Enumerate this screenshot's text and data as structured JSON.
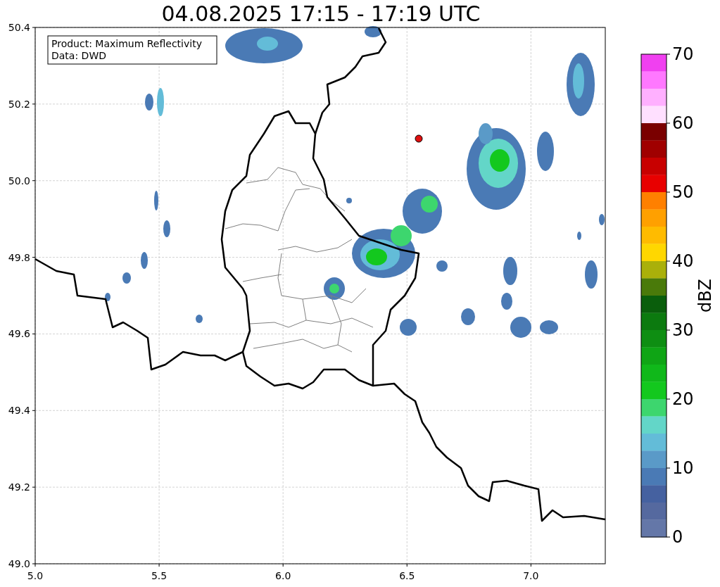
{
  "title": "04.08.2025 17:15 - 17:19 UTC",
  "info_box": {
    "lines": [
      "Product: Maximum Reflectivity",
      "Data: DWD"
    ]
  },
  "map": {
    "x_ticks": [
      "5.0",
      "5.5",
      "6.0",
      "6.5",
      "7.0"
    ],
    "y_ticks": [
      "50.4",
      "50.2",
      "50.0",
      "49.8",
      "49.6",
      "49.4",
      "49.2",
      "49.0"
    ]
  },
  "colorbar": {
    "label": "dBZ",
    "ticks": [
      "70",
      "60",
      "50",
      "40",
      "30",
      "20",
      "10",
      "0"
    ],
    "bins": [
      {
        "color": "#f040f0"
      },
      {
        "color": "#ff78ff"
      },
      {
        "color": "#ffb0ff"
      },
      {
        "color": "#ffe0ff"
      },
      {
        "color": "#7a0000"
      },
      {
        "color": "#a00000"
      },
      {
        "color": "#c80000"
      },
      {
        "color": "#e80000"
      },
      {
        "color": "#ff8000"
      },
      {
        "color": "#ffa000"
      },
      {
        "color": "#ffbb00"
      },
      {
        "color": "#ffd700"
      },
      {
        "color": "#aab00a"
      },
      {
        "color": "#4a7a0a"
      },
      {
        "color": "#0a5e0c"
      },
      {
        "color": "#0c7a0f"
      },
      {
        "color": "#0e8e12"
      },
      {
        "color": "#0fa515"
      },
      {
        "color": "#10b81a"
      },
      {
        "color": "#13c81e"
      },
      {
        "color": "#3dd66e"
      },
      {
        "color": "#63d6c8"
      },
      {
        "color": "#63bcd8"
      },
      {
        "color": "#5a9ac8"
      },
      {
        "color": "#4a7ab5"
      },
      {
        "color": "#4561a0"
      },
      {
        "color": "#55699f"
      },
      {
        "color": "#6477a8"
      }
    ]
  }
}
